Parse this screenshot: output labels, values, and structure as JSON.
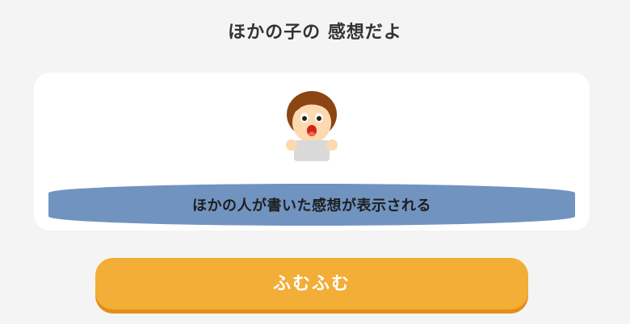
{
  "header": {
    "title": "ほかの子の 感想だよ"
  },
  "card": {
    "avatar_icon": "child-avatar-icon",
    "caption": "ほかの人が書いた感想が表示される",
    "caption_band_color": "#7193c0"
  },
  "action": {
    "ok_label": "ふむふむ",
    "button_color": "#f2ae36"
  }
}
